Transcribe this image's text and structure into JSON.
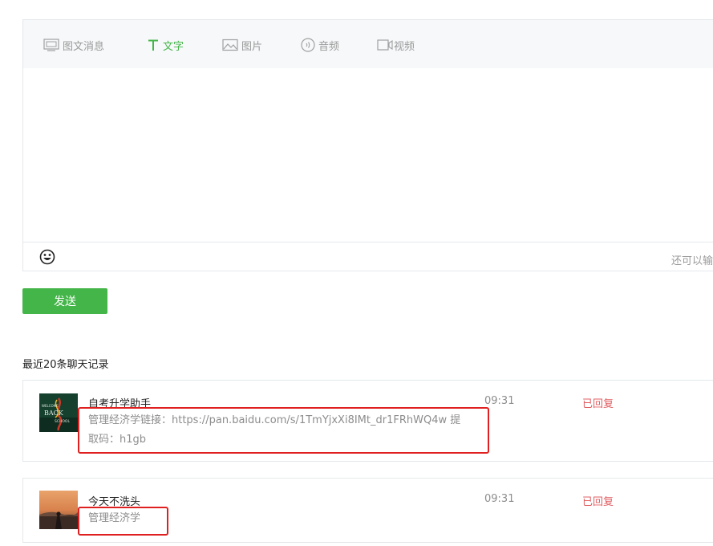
{
  "tabs": [
    {
      "label": "图文消息",
      "icon": "article-icon",
      "active": false
    },
    {
      "label": "文字",
      "icon": "text-icon",
      "active": true
    },
    {
      "label": "图片",
      "icon": "image-icon",
      "active": false
    },
    {
      "label": "音频",
      "icon": "audio-icon",
      "active": false
    },
    {
      "label": "视频",
      "icon": "video-icon",
      "active": false
    }
  ],
  "editor": {
    "hint": "还可以输",
    "emoji_icon": "smiley-icon"
  },
  "send_label": "发送",
  "history": {
    "title": "最近20条聊天记录",
    "messages": [
      {
        "name": "自考升学助手",
        "content_line1": "管理经济学链接：https://pan.baidu.com/s/1TmYjxXi8IMt_dr1FRhWQ4w 提",
        "content_line2": "取码：h1gb",
        "time": "09:31",
        "status": "已回复",
        "avatar_text": [
          "WELCOME",
          "BACK",
          "SCHOOL"
        ]
      },
      {
        "name": "今天不洗头",
        "content_line1": "管理经济学",
        "time": "09:31",
        "status": "已回复"
      }
    ]
  },
  "colors": {
    "accent": "#44b549",
    "status_red": "#e15f63",
    "highlight_box": "#e02020",
    "tab_bg": "#f6f8f9"
  }
}
